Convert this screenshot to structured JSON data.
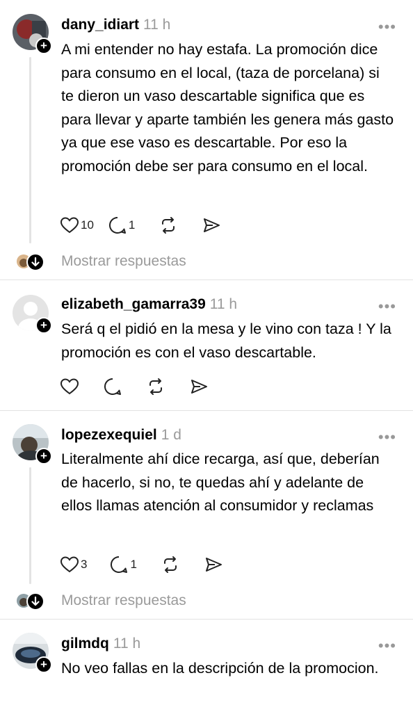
{
  "comments": [
    {
      "username": "dany_idiart",
      "time": "11 h",
      "text": "A mi entender no hay estafa. La promoción dice para consumo en el local, (taza de porcelana) si te dieron un vaso descartable significa que es para llevar y aparte también les genera más gasto ya que ese vaso es descartable. Por eso la promoción debe ser para consumo en el local.",
      "likes": "10",
      "replies": "1",
      "show_replies": "Mostrar respuestas"
    },
    {
      "username": "elizabeth_gamarra39",
      "time": "11 h",
      "text": "Será q el pidió en la mesa y le vino con taza ! Y la promoción es con el vaso descartable."
    },
    {
      "username": "lopezexequiel",
      "time": "1 d",
      "text": "Literalmente ahí dice recarga, así que, deberían de hacerlo, si no, te quedas ahí y adelante de ellos llamas atención al consumidor y reclamas",
      "likes": "3",
      "replies": "1",
      "show_replies": "Mostrar respuestas"
    },
    {
      "username": "gilmdq",
      "time": "11 h",
      "text": "No veo fallas en la descripción de la promocion."
    }
  ],
  "more_glyph": "•••",
  "plus_glyph": "+",
  "icons": [
    "heart-icon",
    "comment-icon",
    "repost-icon",
    "share-icon"
  ]
}
